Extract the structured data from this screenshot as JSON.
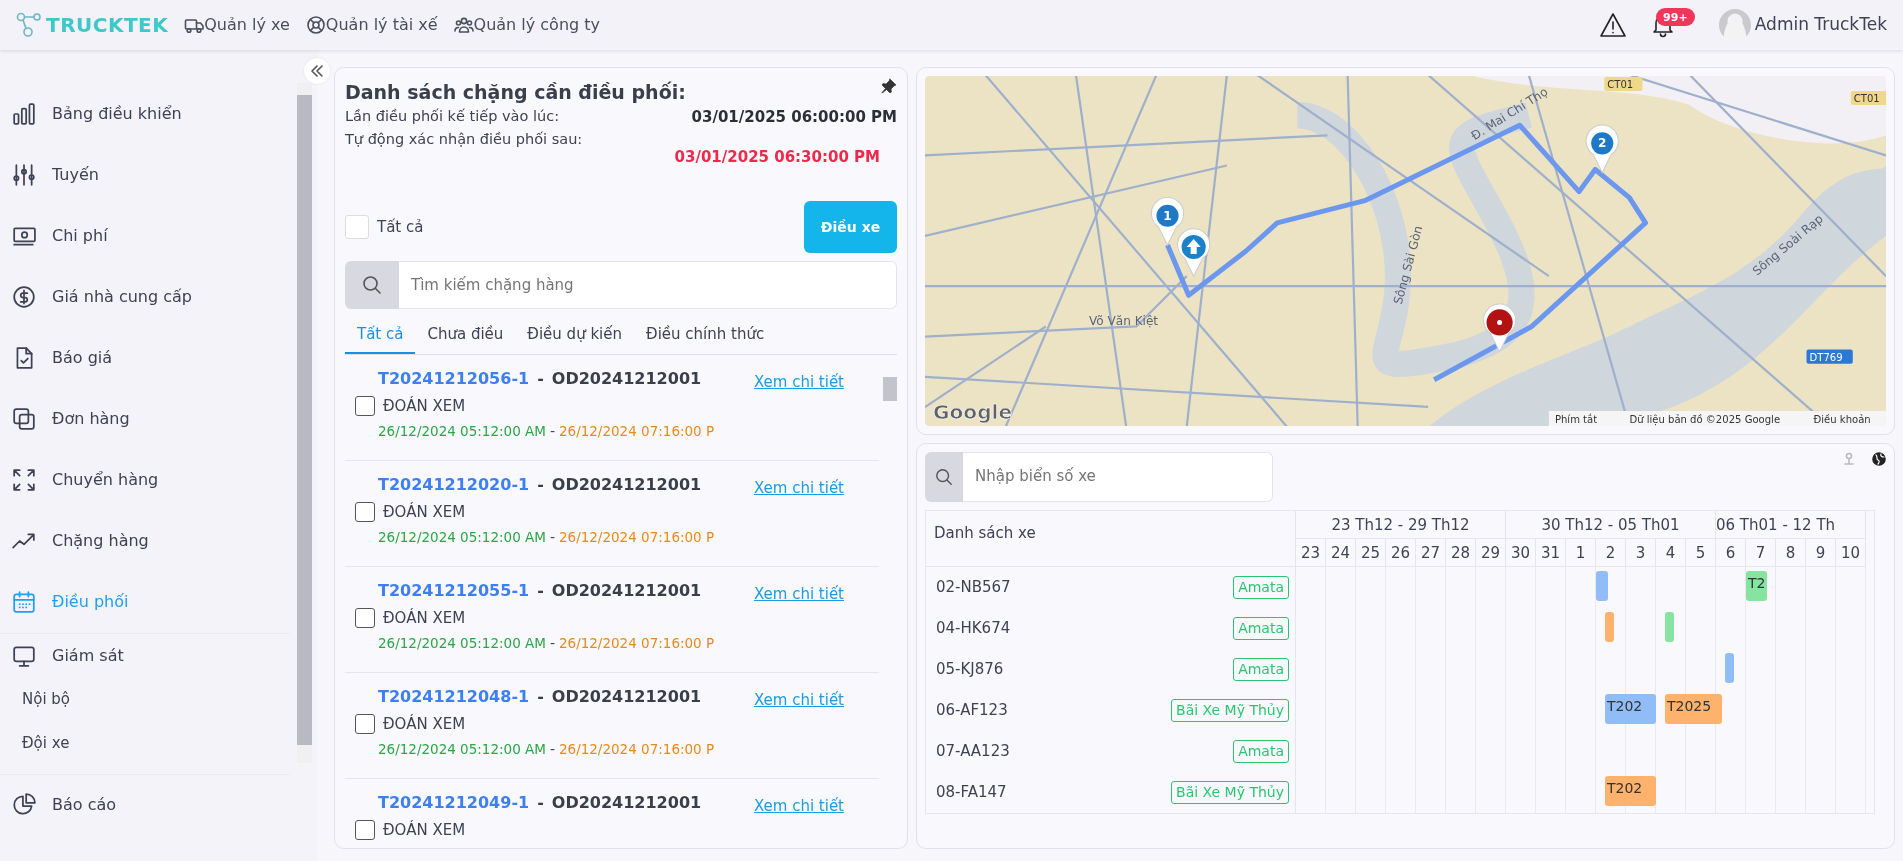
{
  "app": {
    "logo": "TRUCKTEK"
  },
  "nav": [
    {
      "label": "Quản lý xe"
    },
    {
      "label": "Quản lý tài xế"
    },
    {
      "label": "Quản lý công ty"
    }
  ],
  "header": {
    "notification_count": "99+",
    "user": "Admin TruckTek"
  },
  "sidebar": {
    "items": [
      {
        "label": "Bảng điều khiển",
        "selected": false
      },
      {
        "label": "Tuyến",
        "selected": false
      },
      {
        "label": "Chi phí",
        "selected": false
      },
      {
        "label": "Giá nhà cung cấp",
        "selected": false
      },
      {
        "label": "Báo giá",
        "selected": false
      },
      {
        "label": "Đơn hàng",
        "selected": false
      },
      {
        "label": "Chuyển hàng",
        "selected": false
      },
      {
        "label": "Chặng hàng",
        "selected": false
      },
      {
        "label": "Điều phối",
        "selected": true
      },
      {
        "label": "Giám sát",
        "selected": false,
        "children": [
          {
            "label": "Nội bộ",
            "selected": false
          },
          {
            "label": "Đội xe",
            "selected": false
          }
        ]
      },
      {
        "label": "Báo cáo",
        "selected": false
      }
    ]
  },
  "dispatch_panel": {
    "title": "Danh sách chặng cần điều phối:",
    "info": [
      {
        "label": "Lần điều phối kế tiếp vào lúc:",
        "value": "03/01/2025 06:00:00 PM",
        "kind": "normal"
      },
      {
        "label": "Tự động xác nhận điều phối sau:",
        "value": "03/01/2025 06:30:00 PM",
        "kind": "alert"
      }
    ],
    "select_all": {
      "label": "Tất cả",
      "checked": false
    },
    "dispatch_button": "Điều xe",
    "search": {
      "placeholder": "Tìm kiếm chặng hàng"
    },
    "tabs": [
      {
        "label": "Tất cả",
        "selected": true
      },
      {
        "label": "Chưa điều",
        "selected": false
      },
      {
        "label": "Điều dự kiến",
        "selected": false
      },
      {
        "label": "Điều chính thức",
        "selected": false
      }
    ],
    "legs": [
      {
        "code": "T20241212056-1",
        "separator": "-",
        "order": "OD20241212001",
        "name": "ĐOÁN XEM",
        "checked": false,
        "start": "26/12/2024 05:12:00 AM",
        "dash": "-",
        "end": "26/12/2024 07:16:00 P",
        "link": "Xem chi tiết"
      },
      {
        "code": "T20241212020-1",
        "separator": "-",
        "order": "OD20241212001",
        "name": "ĐOÁN XEM",
        "checked": false,
        "start": "26/12/2024 05:12:00 AM",
        "dash": "-",
        "end": "26/12/2024 07:16:00 P",
        "link": "Xem chi tiết"
      },
      {
        "code": "T20241212055-1",
        "separator": "-",
        "order": "OD20241212001",
        "name": "ĐOÁN XEM",
        "checked": false,
        "start": "26/12/2024 05:12:00 AM",
        "dash": "-",
        "end": "26/12/2024 07:16:00 P",
        "link": "Xem chi tiết"
      },
      {
        "code": "T20241212048-1",
        "separator": "-",
        "order": "OD20241212001",
        "name": "ĐOÁN XEM",
        "checked": false,
        "start": "26/12/2024 05:12:00 AM",
        "dash": "-",
        "end": "26/12/2024 07:16:00 P",
        "link": "Xem chi tiết"
      },
      {
        "code": "T20241212049-1",
        "separator": "-",
        "order": "OD20241212001",
        "name": "ĐOÁN XEM",
        "checked": false,
        "link": "Xem chi tiết"
      }
    ]
  },
  "map": {
    "labels": [
      "Võ Văn Kiệt",
      "Sông Sài Gòn",
      "Sông Soài Rạp",
      "Đ. Mai Chí Thọ"
    ],
    "shields": [
      "CT01",
      "CT01",
      "DT769"
    ],
    "pins": [
      {
        "kind": "numbered",
        "label": "1"
      },
      {
        "kind": "vehicle"
      },
      {
        "kind": "numbered",
        "label": "2"
      },
      {
        "kind": "destination"
      }
    ],
    "logo": "Google",
    "attribution": [
      "Phím tắt",
      "Dữ liệu bản đồ ©2025 Google",
      "Điều khoản"
    ]
  },
  "vehicle_schedule": {
    "search": {
      "placeholder": "Nhập biển số xe"
    },
    "list_header": "Danh sách xe",
    "weeks": [
      "23 Th12 - 29 Th12",
      "30 Th12 - 05 Th01",
      "06 Th01 - 12 Th"
    ],
    "days": [
      "23",
      "24",
      "25",
      "26",
      "27",
      "28",
      "29",
      "30",
      "31",
      "1",
      "2",
      "3",
      "4",
      "5",
      "6",
      "7",
      "8",
      "9",
      "10"
    ],
    "rows": [
      {
        "plate": "02-NB567",
        "depot": "Amata",
        "bars": [
          {
            "color": "#90bdf7"
          },
          {
            "color": "#86e3a0",
            "label": "T2"
          }
        ]
      },
      {
        "plate": "04-HK674",
        "depot": "Amata",
        "bars": [
          {
            "color": "#ffb26b"
          },
          {
            "color": "#86e3a0"
          }
        ]
      },
      {
        "plate": "05-KJ876",
        "depot": "Amata",
        "bars": [
          {
            "color": "#90bdf7"
          }
        ]
      },
      {
        "plate": "06-AF123",
        "depot": "Bãi Xe Mỹ Thủy",
        "bars": [
          {
            "color": "#90bdf7",
            "label": "T202"
          },
          {
            "color": "#ffb26b",
            "label": "T2025"
          }
        ]
      },
      {
        "plate": "07-AA123",
        "depot": "Amata",
        "bars": []
      },
      {
        "plate": "08-FA147",
        "depot": "Bãi Xe Mỹ Thủy",
        "bars": [
          {
            "color": "#ffb26b",
            "label": "T202"
          }
        ]
      }
    ]
  }
}
